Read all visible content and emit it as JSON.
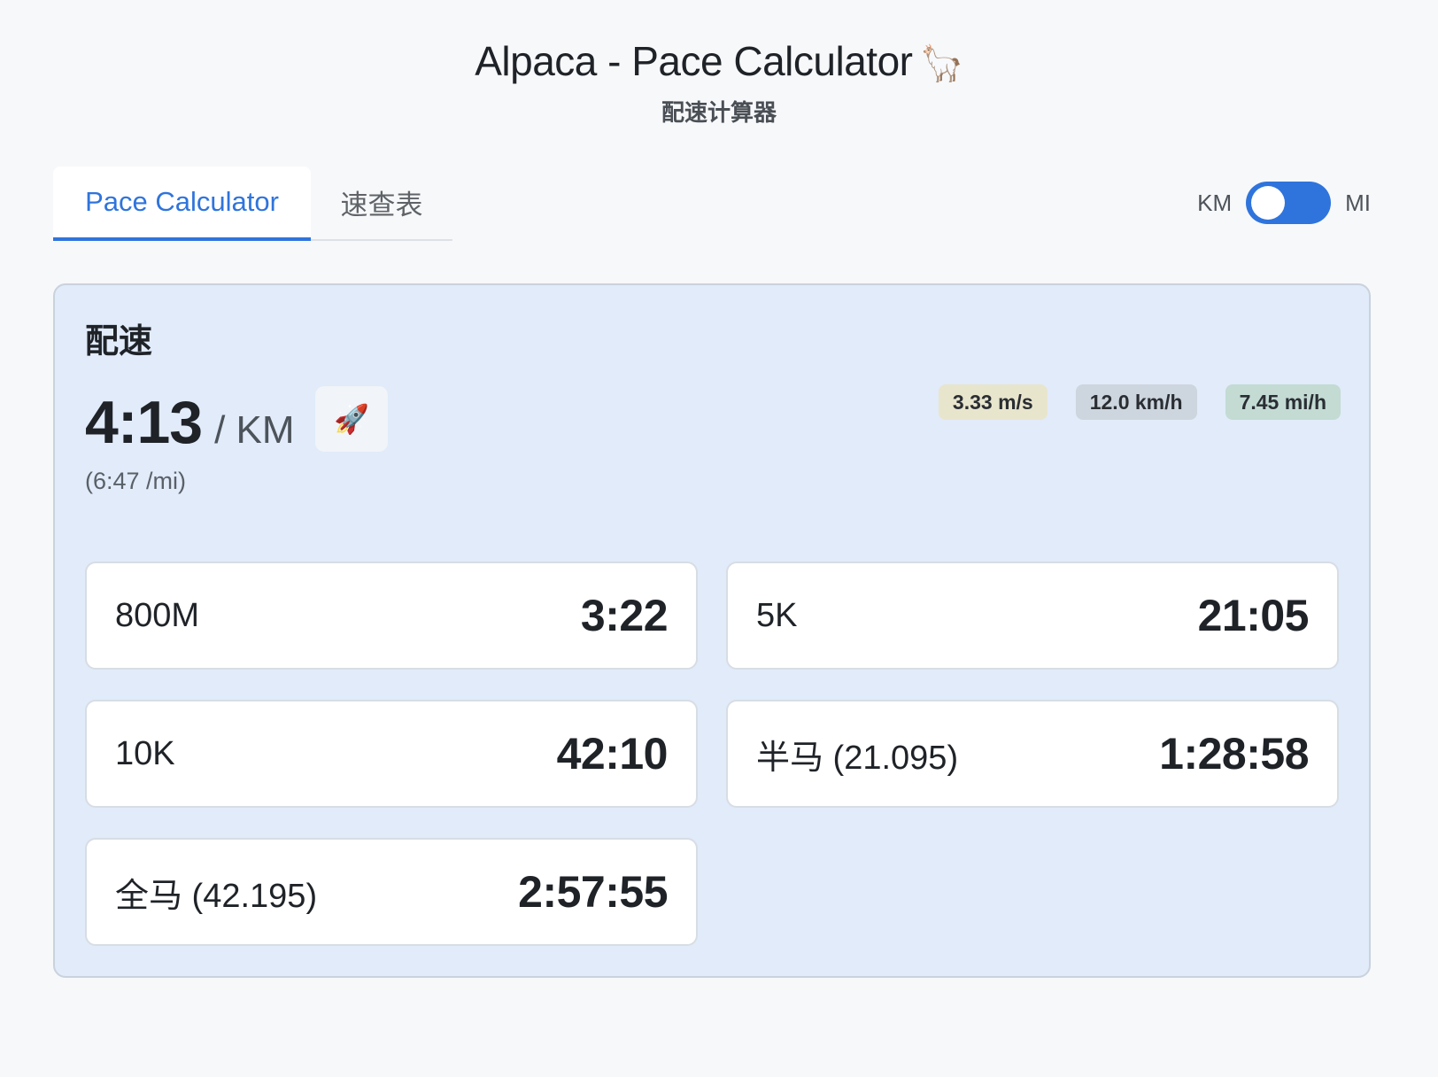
{
  "app": {
    "title": "Alpaca - Pace Calculator",
    "title_emoji": "🦙",
    "subtitle": "配速计算器"
  },
  "tabs": [
    {
      "label": "Pace Calculator",
      "active": true
    },
    {
      "label": "速查表",
      "active": false
    }
  ],
  "unit_toggle": {
    "left_label": "KM",
    "right_label": "MI",
    "selected": "KM"
  },
  "pace_card": {
    "title": "配速",
    "pace": "4:13",
    "unit": "/ KM",
    "alt_pace": "(6:47 /mi)",
    "rocket_icon": "🚀",
    "speeds": [
      "3.33 m/s",
      "12.0 km/h",
      "7.45 mi/h"
    ]
  },
  "races": [
    {
      "name": "800M",
      "time": "3:22"
    },
    {
      "name": "5K",
      "time": "21:05"
    },
    {
      "name": "10K",
      "time": "42:10"
    },
    {
      "name": "半马 (21.095)",
      "time": "1:28:58"
    },
    {
      "name": "全马 (42.195)",
      "time": "2:57:55"
    }
  ],
  "colors": {
    "accent": "#2f74dc",
    "card_bg": "#e1ebf9",
    "badge_ms": "#e8e5cd",
    "badge_kmh": "#cdd5de",
    "badge_mih": "#c3dbd3"
  }
}
